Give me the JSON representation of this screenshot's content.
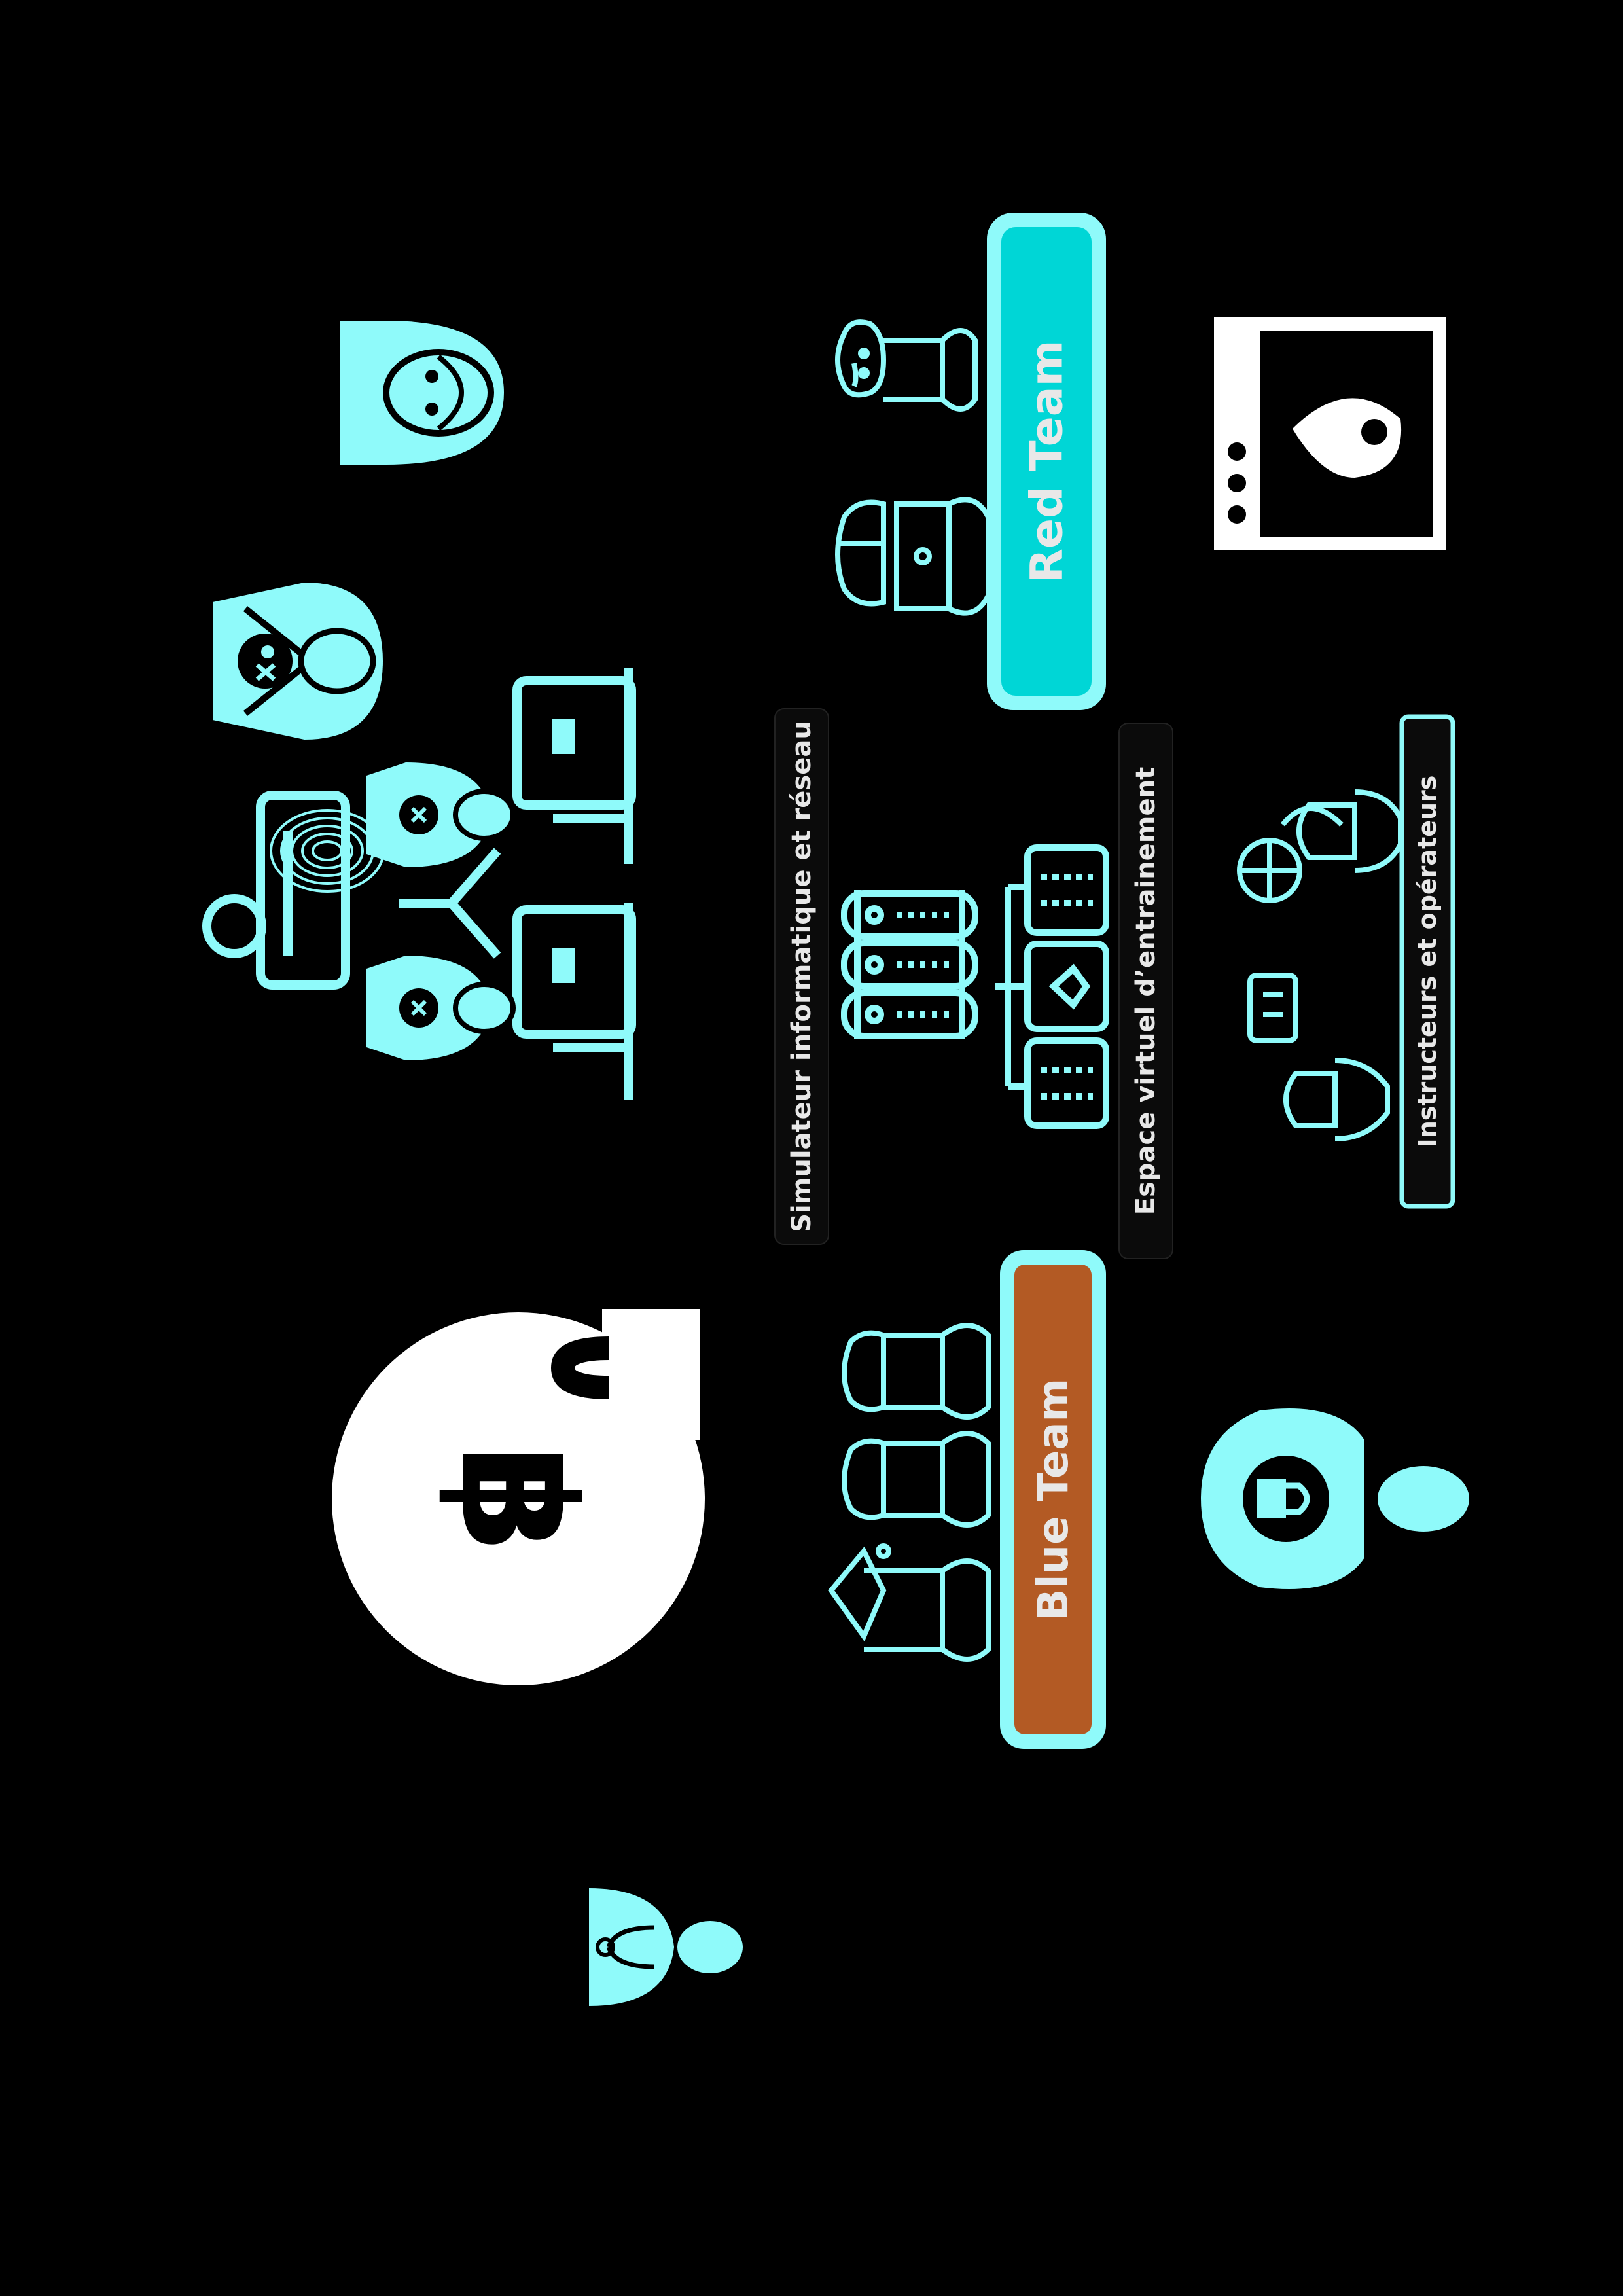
{
  "labels": {
    "red_team": "Red Team",
    "blue_team": "Blue Team",
    "simulator": "Simulateur informatique et réseau",
    "virtual_space": "Espace virtuel d’entrainement",
    "instructors": "Instructeurs et opérateurs"
  },
  "colors": {
    "background": "#000000",
    "cyan": "#8FFAFA",
    "cyan_fill": "#00D6D6",
    "blue_team_fill": "#B35A24",
    "label_bg": "#0B0B0B",
    "label_text": "#E8E8E8",
    "white": "#FFFFFF"
  },
  "icons": [
    "hacker-head-icon",
    "skull-head-icon",
    "attack-network-icon",
    "bitcoin-lock-icon",
    "doctor-icon",
    "red-team-people-icon",
    "server-rack-icon",
    "network-screens-icon",
    "blue-team-people-icon",
    "browser-alert-icon",
    "instructors-people-icon",
    "secure-user-icon"
  ]
}
